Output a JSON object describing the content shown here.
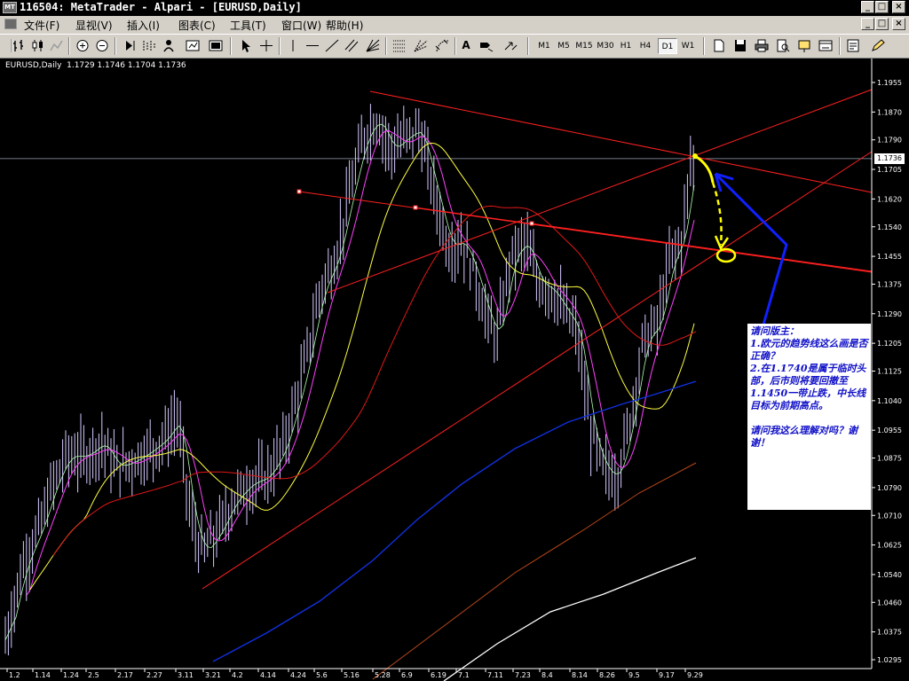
{
  "window": {
    "title": "116504: MetaTrader - Alpari - [EURUSD,Daily]",
    "app_icon_text": "MT",
    "controls": [
      "_",
      "□",
      "×"
    ],
    "doc_controls": [
      "_",
      "□",
      "×"
    ]
  },
  "menu": [
    "文件(F)",
    "显视(V)",
    "插入(I)",
    "图表(C)",
    "工具(T)",
    "窗口(W)",
    "帮助(H)"
  ],
  "toolbar": {
    "timeframes": [
      "M1",
      "M5",
      "M15",
      "M30",
      "H1",
      "H4",
      "D1",
      "W1"
    ],
    "active_timeframe": "D1",
    "text_tool": "A"
  },
  "chart": {
    "label": "EURUSD,Daily  1.1729 1.1746 1.1704 1.1736",
    "current_price": "1.1736",
    "price_ticks": [
      "1.1955",
      "1.1870",
      "1.1790",
      "1.1705",
      "1.1620",
      "1.1540",
      "1.1455",
      "1.1375",
      "1.1290",
      "1.1205",
      "1.1125",
      "1.1040",
      "1.0955",
      "1.0875",
      "1.0790",
      "1.0710",
      "1.0625",
      "1.0540",
      "1.0460",
      "1.0375",
      "1.0295"
    ],
    "date_ticks": [
      "1.2",
      "1.14",
      "1.24",
      "2.5",
      "2.17",
      "2.27",
      "3.11",
      "3.21",
      "4.2",
      "4.14",
      "4.24",
      "5.6",
      "5.16",
      "5.28",
      "6.9",
      "6.19",
      "7.1",
      "7.11",
      "7.23",
      "8.4",
      "8.14",
      "8.26",
      "9.5",
      "9.17",
      "9.29"
    ],
    "colors": {
      "background": "#000000",
      "bars": "#d6c8ff",
      "trendlines": "#ff2020",
      "ma_fast": "#b0ffb0",
      "ma_magenta": "#ff40ff",
      "ma_yellow": "#ffff40",
      "ma_red": "#e01818",
      "ma_blue": "#1030e0",
      "ma_brown": "#b84818",
      "ma_white": "#ffffff",
      "annotation_yellow": "#ffff00",
      "annotation_blue": "#1020ff"
    }
  },
  "note": {
    "lines": [
      "请问版主：",
      "1.欧元的趋势线这么画是否正确？",
      "2.在1.1740是属于临时头部，后市则将要回撤至1.1450一带止跌，中长线目标为前期高点。",
      "",
      "请问我这么理解对吗？谢谢！"
    ]
  }
}
